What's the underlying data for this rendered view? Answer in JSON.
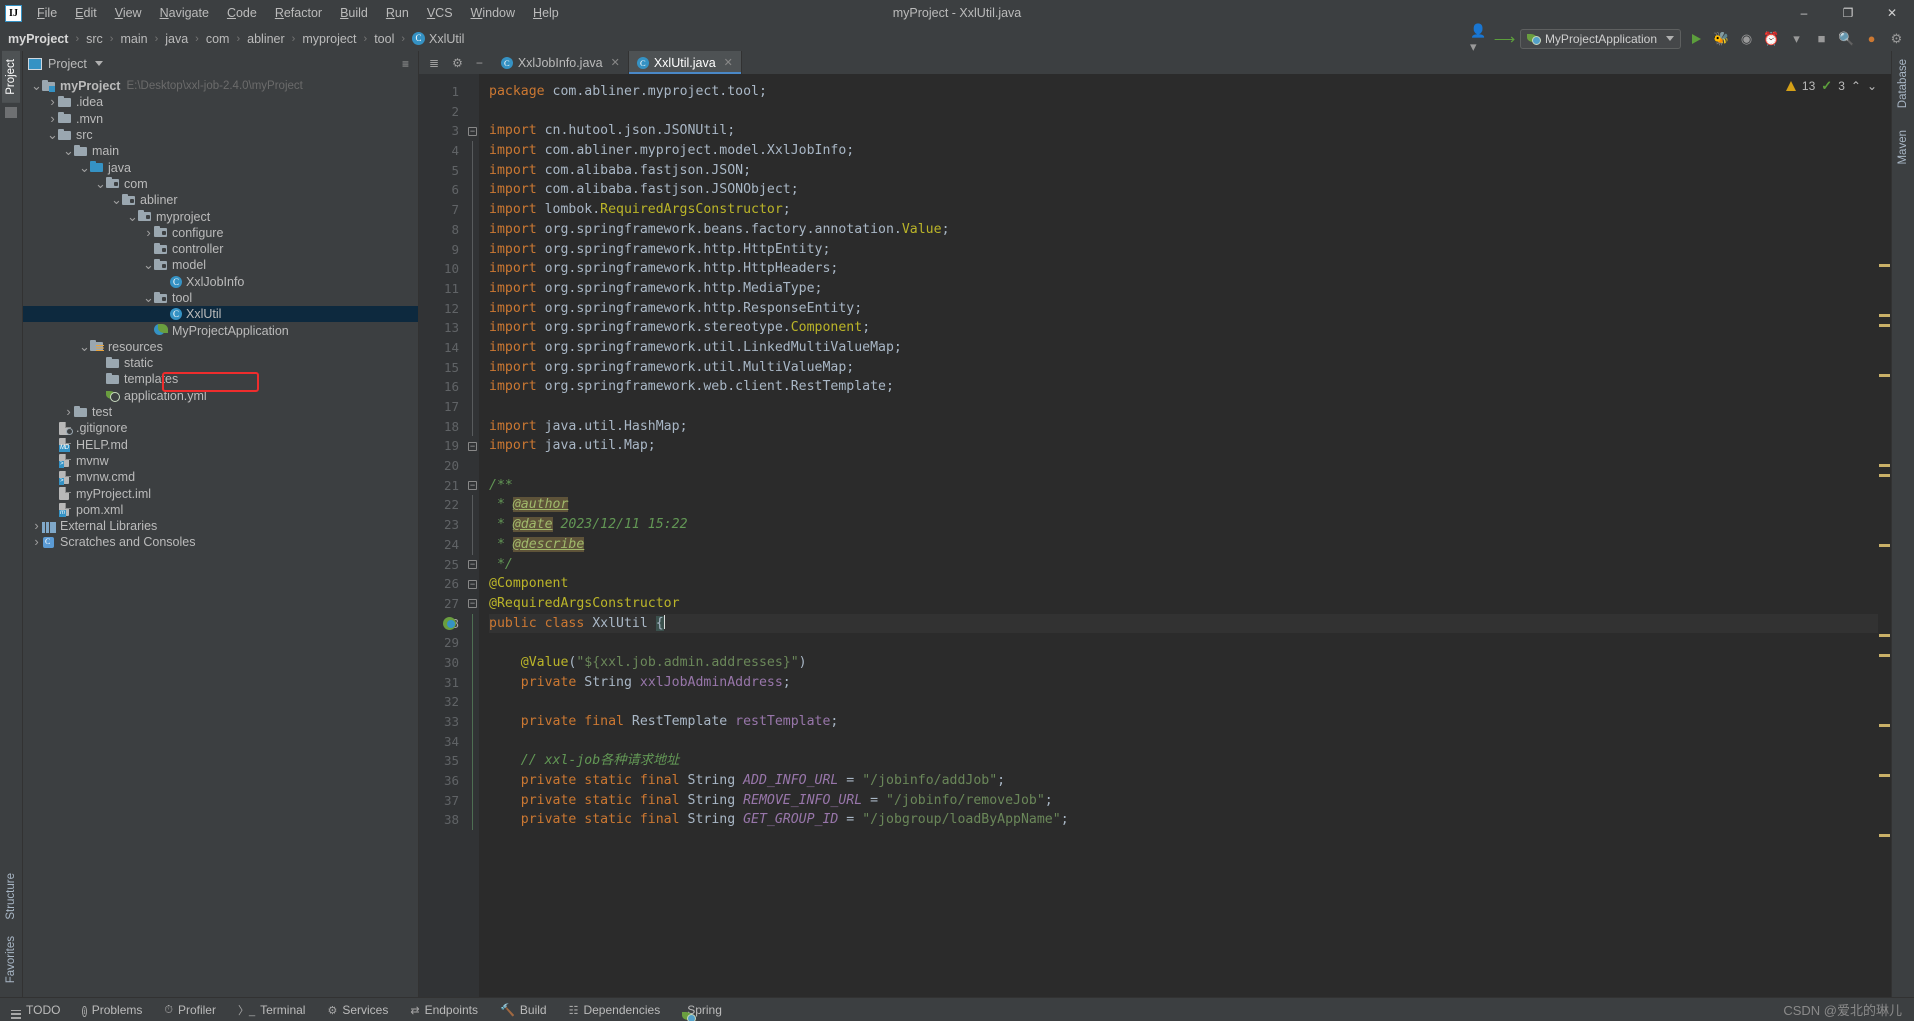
{
  "window": {
    "title": "myProject - XxlUtil.java",
    "minimize": "–",
    "maximize": "❐",
    "close": "✕"
  },
  "menu": {
    "items": [
      "File",
      "Edit",
      "View",
      "Navigate",
      "Code",
      "Refactor",
      "Build",
      "Run",
      "VCS",
      "Window",
      "Help"
    ]
  },
  "breadcrumb": {
    "items": [
      "myProject",
      "src",
      "main",
      "java",
      "com",
      "abliner",
      "myproject",
      "tool"
    ],
    "file": "XxlUtil",
    "separator": "›"
  },
  "toolbar": {
    "run_config": "MyProjectApplication",
    "run_label": "Run",
    "debug_label": "Debug",
    "profile_label": "Profile",
    "coverage_label": "Run with Coverage",
    "stop_label": "Stop",
    "search_label": "Search Everywhere",
    "settings_label": "Settings",
    "updates_label": "Updates",
    "account_label": "Account"
  },
  "project_panel": {
    "title": "Project",
    "collapse_label": "Collapse All",
    "settings_label": "Options",
    "hide_label": "Hide",
    "tree": [
      {
        "label": "myProject",
        "sub": "E:\\Desktop\\xxl-job-2.4.0\\myProject",
        "depth": 0,
        "arrow": "v",
        "icon": "folder-prj",
        "bold": true
      },
      {
        "label": ".idea",
        "sub": "",
        "depth": 1,
        "arrow": ">",
        "icon": "folder",
        "bold": false
      },
      {
        "label": ".mvn",
        "sub": "",
        "depth": 1,
        "arrow": ">",
        "icon": "folder",
        "bold": false
      },
      {
        "label": "src",
        "sub": "",
        "depth": 1,
        "arrow": "v",
        "icon": "folder",
        "bold": false
      },
      {
        "label": "main",
        "sub": "",
        "depth": 2,
        "arrow": "v",
        "icon": "folder",
        "bold": false
      },
      {
        "label": "java",
        "sub": "",
        "depth": 3,
        "arrow": "v",
        "icon": "folder-src",
        "bold": false
      },
      {
        "label": "com",
        "sub": "",
        "depth": 4,
        "arrow": "v",
        "icon": "folder-mod",
        "bold": false
      },
      {
        "label": "abliner",
        "sub": "",
        "depth": 5,
        "arrow": "v",
        "icon": "folder-mod",
        "bold": false
      },
      {
        "label": "myproject",
        "sub": "",
        "depth": 6,
        "arrow": "v",
        "icon": "folder-mod",
        "bold": false
      },
      {
        "label": "configure",
        "sub": "",
        "depth": 7,
        "arrow": ">",
        "icon": "folder-mod",
        "bold": false
      },
      {
        "label": "controller",
        "sub": "",
        "depth": 7,
        "arrow": "",
        "icon": "folder-mod",
        "bold": false
      },
      {
        "label": "model",
        "sub": "",
        "depth": 7,
        "arrow": "v",
        "icon": "folder-mod",
        "bold": false
      },
      {
        "label": "XxlJobInfo",
        "sub": "",
        "depth": 8,
        "arrow": "",
        "icon": "cls",
        "bold": false
      },
      {
        "label": "tool",
        "sub": "",
        "depth": 7,
        "arrow": "v",
        "icon": "folder-mod",
        "bold": false
      },
      {
        "label": "XxlUtil",
        "sub": "",
        "depth": 8,
        "arrow": "",
        "icon": "cls",
        "bold": false,
        "selected": true
      },
      {
        "label": "MyProjectApplication",
        "sub": "",
        "depth": 7,
        "arrow": "",
        "icon": "springapp",
        "bold": false
      },
      {
        "label": "resources",
        "sub": "",
        "depth": 3,
        "arrow": "v",
        "icon": "folder-res",
        "bold": false
      },
      {
        "label": "static",
        "sub": "",
        "depth": 4,
        "arrow": "",
        "icon": "folder",
        "bold": false
      },
      {
        "label": "templates",
        "sub": "",
        "depth": 4,
        "arrow": "",
        "icon": "folder",
        "bold": false
      },
      {
        "label": "application.yml",
        "sub": "",
        "depth": 4,
        "arrow": "",
        "icon": "spring-file",
        "bold": false
      },
      {
        "label": "test",
        "sub": "",
        "depth": 2,
        "arrow": ">",
        "icon": "folder",
        "bold": false
      },
      {
        "label": ".gitignore",
        "sub": "",
        "depth": 1,
        "arrow": "",
        "icon": "file-git",
        "bold": false
      },
      {
        "label": "HELP.md",
        "sub": "",
        "depth": 1,
        "arrow": "",
        "icon": "file-md",
        "bold": false
      },
      {
        "label": "mvnw",
        "sub": "",
        "depth": 1,
        "arrow": "",
        "icon": "file-sh",
        "bold": false
      },
      {
        "label": "mvnw.cmd",
        "sub": "",
        "depth": 1,
        "arrow": "",
        "icon": "file-cmd",
        "bold": false
      },
      {
        "label": "myProject.iml",
        "sub": "",
        "depth": 1,
        "arrow": "",
        "icon": "file-iml",
        "bold": false
      },
      {
        "label": "pom.xml",
        "sub": "",
        "depth": 1,
        "arrow": "",
        "icon": "file-pom",
        "bold": false
      },
      {
        "label": "External Libraries",
        "sub": "",
        "depth": 0,
        "arrow": ">",
        "icon": "libs",
        "bold": false
      },
      {
        "label": "Scratches and Consoles",
        "sub": "",
        "depth": 0,
        "arrow": ">",
        "icon": "scratch",
        "bold": false
      }
    ]
  },
  "left_strip": {
    "project_tab": "Project",
    "structure_tab": "Structure",
    "favorites_tab": "Favorites"
  },
  "right_strip": {
    "database_tab": "Database",
    "maven_tab": "Maven"
  },
  "editor": {
    "tabs": [
      {
        "label": "XxlJobInfo.java",
        "active": false,
        "close": "✕"
      },
      {
        "label": "XxlUtil.java",
        "active": true,
        "close": "✕"
      }
    ],
    "inspections": {
      "warnings": "13",
      "oks": "3",
      "up": "⌃",
      "down": "⌄"
    },
    "first_line_number": 1,
    "lines": [
      {
        "n": 1,
        "fold": "",
        "tokens": [
          {
            "t": "package ",
            "c": "kw"
          },
          {
            "t": "com.abliner.myproject.tool",
            "c": "txt"
          },
          {
            "t": ";",
            "c": "txt"
          }
        ]
      },
      {
        "n": 2,
        "fold": "",
        "tokens": []
      },
      {
        "n": 3,
        "fold": "minus",
        "tokens": [
          {
            "t": "import ",
            "c": "kw"
          },
          {
            "t": "cn.hutool.json.JSONUtil",
            "c": "txt"
          },
          {
            "t": ";",
            "c": "txt"
          }
        ]
      },
      {
        "n": 4,
        "fold": "line",
        "tokens": [
          {
            "t": "import ",
            "c": "kw"
          },
          {
            "t": "com.abliner.myproject.model.XxlJobInfo",
            "c": "txt"
          },
          {
            "t": ";",
            "c": "txt"
          }
        ]
      },
      {
        "n": 5,
        "fold": "line",
        "tokens": [
          {
            "t": "import ",
            "c": "kw"
          },
          {
            "t": "com.alibaba.fastjson.JSON",
            "c": "txt"
          },
          {
            "t": ";",
            "c": "txt"
          }
        ]
      },
      {
        "n": 6,
        "fold": "line",
        "tokens": [
          {
            "t": "import ",
            "c": "kw"
          },
          {
            "t": "com.alibaba.fastjson.JSONObject",
            "c": "txt"
          },
          {
            "t": ";",
            "c": "txt"
          }
        ]
      },
      {
        "n": 7,
        "fold": "line",
        "tokens": [
          {
            "t": "import ",
            "c": "kw"
          },
          {
            "t": "lombok.",
            "c": "txt"
          },
          {
            "t": "RequiredArgsConstructor",
            "c": "anno"
          },
          {
            "t": ";",
            "c": "txt"
          }
        ]
      },
      {
        "n": 8,
        "fold": "line",
        "tokens": [
          {
            "t": "import ",
            "c": "kw"
          },
          {
            "t": "org.springframework.beans.factory.annotation.",
            "c": "txt"
          },
          {
            "t": "Value",
            "c": "anno"
          },
          {
            "t": ";",
            "c": "txt"
          }
        ]
      },
      {
        "n": 9,
        "fold": "line",
        "tokens": [
          {
            "t": "import ",
            "c": "kw"
          },
          {
            "t": "org.springframework.http.HttpEntity",
            "c": "txt"
          },
          {
            "t": ";",
            "c": "txt"
          }
        ]
      },
      {
        "n": 10,
        "fold": "line",
        "tokens": [
          {
            "t": "import ",
            "c": "kw"
          },
          {
            "t": "org.springframework.http.HttpHeaders",
            "c": "txt"
          },
          {
            "t": ";",
            "c": "txt"
          }
        ]
      },
      {
        "n": 11,
        "fold": "line",
        "tokens": [
          {
            "t": "import ",
            "c": "kw"
          },
          {
            "t": "org.springframework.http.MediaType",
            "c": "txt"
          },
          {
            "t": ";",
            "c": "txt"
          }
        ]
      },
      {
        "n": 12,
        "fold": "line",
        "tokens": [
          {
            "t": "import ",
            "c": "kw"
          },
          {
            "t": "org.springframework.http.ResponseEntity",
            "c": "txt"
          },
          {
            "t": ";",
            "c": "txt"
          }
        ]
      },
      {
        "n": 13,
        "fold": "line",
        "tokens": [
          {
            "t": "import ",
            "c": "kw"
          },
          {
            "t": "org.springframework.stereotype.",
            "c": "txt"
          },
          {
            "t": "Component",
            "c": "anno"
          },
          {
            "t": ";",
            "c": "txt"
          }
        ]
      },
      {
        "n": 14,
        "fold": "line",
        "tokens": [
          {
            "t": "import ",
            "c": "kw"
          },
          {
            "t": "org.springframework.util.LinkedMultiValueMap",
            "c": "txt"
          },
          {
            "t": ";",
            "c": "txt"
          }
        ]
      },
      {
        "n": 15,
        "fold": "line",
        "tokens": [
          {
            "t": "import ",
            "c": "kw"
          },
          {
            "t": "org.springframework.util.MultiValueMap",
            "c": "txt"
          },
          {
            "t": ";",
            "c": "txt"
          }
        ]
      },
      {
        "n": 16,
        "fold": "line",
        "tokens": [
          {
            "t": "import ",
            "c": "kw"
          },
          {
            "t": "org.springframework.web.client.RestTemplate",
            "c": "txt"
          },
          {
            "t": ";",
            "c": "txt"
          }
        ]
      },
      {
        "n": 17,
        "fold": "line",
        "tokens": []
      },
      {
        "n": 18,
        "fold": "line",
        "tokens": [
          {
            "t": "import ",
            "c": "kw"
          },
          {
            "t": "java.util.HashMap",
            "c": "txt"
          },
          {
            "t": ";",
            "c": "txt"
          }
        ]
      },
      {
        "n": 19,
        "fold": "minus-end",
        "tokens": [
          {
            "t": "import ",
            "c": "kw"
          },
          {
            "t": "java.util.Map",
            "c": "txt"
          },
          {
            "t": ";",
            "c": "txt"
          }
        ]
      },
      {
        "n": 20,
        "fold": "",
        "tokens": []
      },
      {
        "n": 21,
        "fold": "minus",
        "tokens": [
          {
            "t": "/**",
            "c": "cmt"
          }
        ]
      },
      {
        "n": 22,
        "fold": "line",
        "tokens": [
          {
            "t": " * ",
            "c": "cmt"
          },
          {
            "t": "@author",
            "c": "jdoc-tag"
          }
        ]
      },
      {
        "n": 23,
        "fold": "line",
        "tokens": [
          {
            "t": " * ",
            "c": "cmt"
          },
          {
            "t": "@date",
            "c": "jdoc-tag"
          },
          {
            "t": " 2023/12/11 15:22",
            "c": "jdoc-val"
          }
        ]
      },
      {
        "n": 24,
        "fold": "line",
        "tokens": [
          {
            "t": " * ",
            "c": "cmt"
          },
          {
            "t": "@describe",
            "c": "jdoc-tag"
          }
        ]
      },
      {
        "n": 25,
        "fold": "minus-end",
        "tokens": [
          {
            "t": " */",
            "c": "cmt"
          }
        ]
      },
      {
        "n": 26,
        "fold": "minus",
        "tokens": [
          {
            "t": "@Component",
            "c": "anno"
          }
        ]
      },
      {
        "n": 27,
        "fold": "minus-end",
        "tokens": [
          {
            "t": "@RequiredArgsConstructor",
            "c": "anno"
          }
        ]
      },
      {
        "n": 28,
        "fold": "bar",
        "gutter_icon": "spring-bean",
        "current": true,
        "tokens": [
          {
            "t": "public ",
            "c": "kw"
          },
          {
            "t": "class ",
            "c": "kw"
          },
          {
            "t": "XxlUtil ",
            "c": "txt"
          },
          {
            "t": "{",
            "c": "brace"
          },
          {
            "t": "|",
            "c": "caret"
          }
        ]
      },
      {
        "n": 29,
        "fold": "bar",
        "tokens": []
      },
      {
        "n": 30,
        "fold": "bar",
        "tokens": [
          {
            "t": "    ",
            "c": "txt"
          },
          {
            "t": "@Value",
            "c": "anno"
          },
          {
            "t": "(",
            "c": "txt"
          },
          {
            "t": "\"${xxl.job.admin.addresses}\"",
            "c": "str"
          },
          {
            "t": ")",
            "c": "txt"
          }
        ]
      },
      {
        "n": 31,
        "fold": "bar",
        "tokens": [
          {
            "t": "    ",
            "c": "txt"
          },
          {
            "t": "private ",
            "c": "kw"
          },
          {
            "t": "String ",
            "c": "txt"
          },
          {
            "t": "xxlJobAdminAddress",
            "c": "fld"
          },
          {
            "t": ";",
            "c": "txt"
          }
        ]
      },
      {
        "n": 32,
        "fold": "bar",
        "tokens": []
      },
      {
        "n": 33,
        "fold": "bar",
        "tokens": [
          {
            "t": "    ",
            "c": "txt"
          },
          {
            "t": "private final ",
            "c": "kw"
          },
          {
            "t": "RestTemplate ",
            "c": "txt"
          },
          {
            "t": "restTemplate",
            "c": "fld"
          },
          {
            "t": ";",
            "c": "txt"
          }
        ]
      },
      {
        "n": 34,
        "fold": "bar",
        "tokens": []
      },
      {
        "n": 35,
        "fold": "bar",
        "tokens": [
          {
            "t": "    ",
            "c": "txt"
          },
          {
            "t": "// xxl-job各种请求地址",
            "c": "cmt"
          }
        ]
      },
      {
        "n": 36,
        "fold": "bar",
        "tokens": [
          {
            "t": "    ",
            "c": "txt"
          },
          {
            "t": "private static final ",
            "c": "kw"
          },
          {
            "t": "String ",
            "c": "txt"
          },
          {
            "t": "ADD_INFO_URL",
            "c": "sfld"
          },
          {
            "t": " = ",
            "c": "txt"
          },
          {
            "t": "\"/jobinfo/addJob\"",
            "c": "str"
          },
          {
            "t": ";",
            "c": "txt"
          }
        ]
      },
      {
        "n": 37,
        "fold": "bar",
        "tokens": [
          {
            "t": "    ",
            "c": "txt"
          },
          {
            "t": "private static final ",
            "c": "kw"
          },
          {
            "t": "String ",
            "c": "txt"
          },
          {
            "t": "REMOVE_INFO_URL",
            "c": "sfld"
          },
          {
            "t": " = ",
            "c": "txt"
          },
          {
            "t": "\"/jobinfo/removeJob\"",
            "c": "str"
          },
          {
            "t": ";",
            "c": "txt"
          }
        ]
      },
      {
        "n": 38,
        "fold": "bar",
        "tokens": [
          {
            "t": "    ",
            "c": "txt"
          },
          {
            "t": "private static final ",
            "c": "kw"
          },
          {
            "t": "String ",
            "c": "txt"
          },
          {
            "t": "GET_GROUP_ID",
            "c": "sfld"
          },
          {
            "t": " = ",
            "c": "txt"
          },
          {
            "t": "\"/jobgroup/loadByAppName\"",
            "c": "str"
          },
          {
            "t": ";",
            "c": "txt"
          }
        ]
      }
    ]
  },
  "statusbar": {
    "items": [
      {
        "label": "TODO",
        "icon": "hamburger-icon"
      },
      {
        "label": "Problems",
        "icon": "info-icon"
      },
      {
        "label": "Profiler",
        "icon": "gauge-icon"
      },
      {
        "label": "Terminal",
        "icon": "terminal-icon"
      },
      {
        "label": "Services",
        "icon": "services-icon"
      },
      {
        "label": "Endpoints",
        "icon": "endpoints-icon"
      },
      {
        "label": "Build",
        "icon": "hammer-icon"
      },
      {
        "label": "Dependencies",
        "icon": "dependencies-icon"
      },
      {
        "label": "Spring",
        "icon": "spring-icon"
      }
    ],
    "watermark": "CSDN @爱北的琳儿"
  },
  "colors": {
    "accent": "#3592c4",
    "selection": "#0d293e",
    "highlight_box": "#ef2d2d",
    "editor_bg": "#2b2b2b",
    "panel_bg": "#3c3f41",
    "keyword": "#cc7832",
    "string": "#6a8759",
    "annotation": "#bbb529",
    "comment": "#629755",
    "field": "#9876aa",
    "text": "#a9b7c6"
  }
}
